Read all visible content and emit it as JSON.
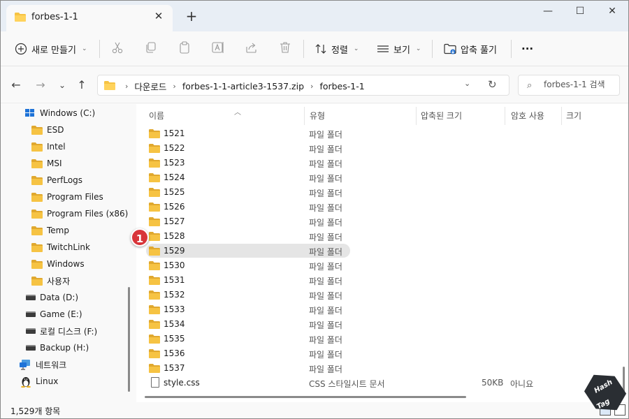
{
  "tab": {
    "title": "forbes-1-1",
    "close": "✕",
    "new_tab": "+"
  },
  "window_controls": {
    "minimize": "—",
    "maximize": "☐",
    "close": "✕"
  },
  "toolbar": {
    "new_label": "새로 만들기",
    "sort_label": "정렬",
    "view_label": "보기",
    "extract_label": "압축 풀기",
    "more_label": "···",
    "icons": [
      "cut-icon",
      "copy-icon",
      "paste-icon",
      "rename-icon",
      "share-icon",
      "delete-icon"
    ]
  },
  "address": {
    "crumbs": [
      "다운로드",
      "forbes-1-1-article3-1537.zip",
      "forbes-1-1"
    ],
    "separator": "›"
  },
  "search": {
    "placeholder": "forbes-1-1 검색"
  },
  "sidebar": {
    "items": [
      {
        "label": "Windows (C:)",
        "kind": "drive-win"
      },
      {
        "label": "ESD",
        "kind": "folder"
      },
      {
        "label": "Intel",
        "kind": "folder"
      },
      {
        "label": "MSI",
        "kind": "folder"
      },
      {
        "label": "PerfLogs",
        "kind": "folder"
      },
      {
        "label": "Program Files",
        "kind": "folder"
      },
      {
        "label": "Program Files (x86)",
        "kind": "folder"
      },
      {
        "label": "Temp",
        "kind": "folder"
      },
      {
        "label": "TwitchLink",
        "kind": "folder"
      },
      {
        "label": "Windows",
        "kind": "folder"
      },
      {
        "label": "사용자",
        "kind": "folder"
      },
      {
        "label": "Data (D:)",
        "kind": "drive"
      },
      {
        "label": "Game (E:)",
        "kind": "drive"
      },
      {
        "label": "로컬 디스크 (F:)",
        "kind": "drive"
      },
      {
        "label": "Backup (H:)",
        "kind": "drive"
      },
      {
        "label": "네트워크",
        "kind": "network"
      },
      {
        "label": "Linux",
        "kind": "linux"
      }
    ]
  },
  "columns": {
    "name": "이름",
    "type": "유형",
    "compressed_size": "압축된 크기",
    "password": "암호 사용",
    "size": "크기"
  },
  "files": [
    {
      "name": "1521",
      "type": "파일 폴더"
    },
    {
      "name": "1522",
      "type": "파일 폴더"
    },
    {
      "name": "1523",
      "type": "파일 폴더"
    },
    {
      "name": "1524",
      "type": "파일 폴더"
    },
    {
      "name": "1525",
      "type": "파일 폴더"
    },
    {
      "name": "1526",
      "type": "파일 폴더"
    },
    {
      "name": "1527",
      "type": "파일 폴더"
    },
    {
      "name": "1528",
      "type": "파일 폴더"
    },
    {
      "name": "1529",
      "type": "파일 폴더",
      "highlighted": true
    },
    {
      "name": "1530",
      "type": "파일 폴더"
    },
    {
      "name": "1531",
      "type": "파일 폴더"
    },
    {
      "name": "1532",
      "type": "파일 폴더"
    },
    {
      "name": "1533",
      "type": "파일 폴더"
    },
    {
      "name": "1534",
      "type": "파일 폴더"
    },
    {
      "name": "1535",
      "type": "파일 폴더"
    },
    {
      "name": "1536",
      "type": "파일 폴더"
    },
    {
      "name": "1537",
      "type": "파일 폴더"
    },
    {
      "name": "style.css",
      "type": "CSS 스타일시트 문서",
      "compressed_size": "50KB",
      "password": "아니요",
      "is_file": true
    }
  ],
  "callout": "1",
  "status": {
    "item_count": "1,529개 항목"
  },
  "watermark": {
    "line1": "Hash",
    "line2": "Tag"
  },
  "colors": {
    "folder": "#f6c343",
    "folder_dark": "#e0a82e",
    "highlight": "#e5e5e5",
    "badge": "#d8353a"
  }
}
